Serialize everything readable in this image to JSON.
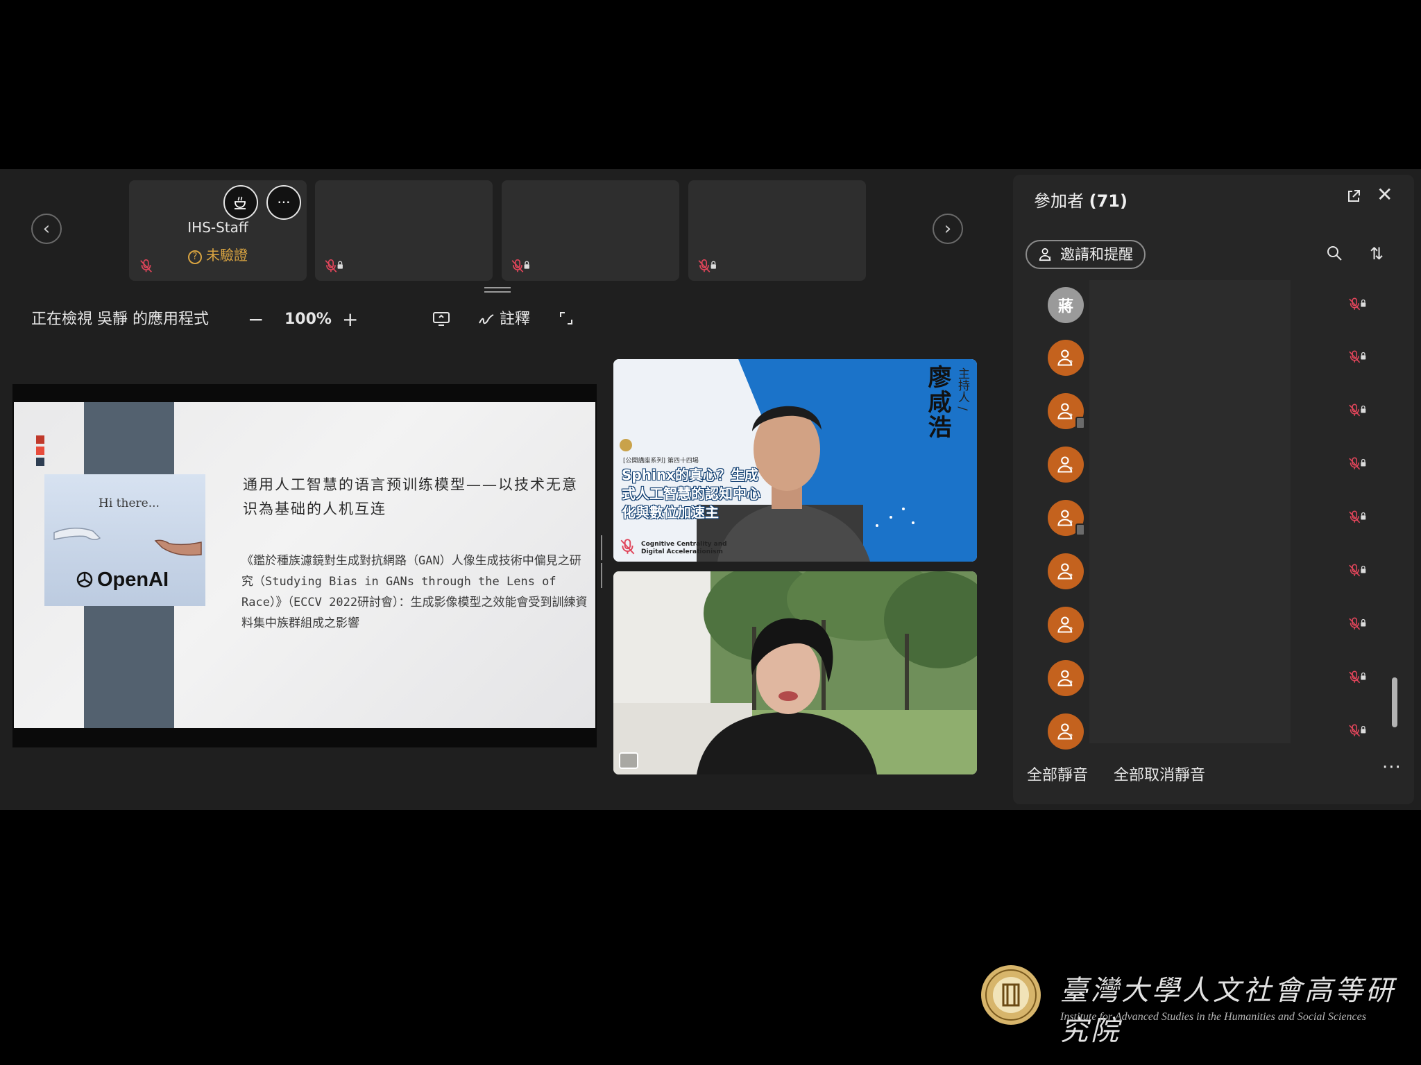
{
  "thumbnails": [
    {
      "name": "IHS-Staff",
      "status": "未驗證"
    },
    {
      "name": "",
      "status": ""
    },
    {
      "name": "",
      "status": ""
    },
    {
      "name": "",
      "status": ""
    }
  ],
  "toolbar": {
    "viewing_label": "正在檢視 吳靜 的應用程式",
    "zoom_minus": "−",
    "zoom_level": "100%",
    "zoom_plus": "+",
    "annotate_label": "註釋"
  },
  "slide": {
    "title": "通用人工智慧的语言预训练模型——以技术无意识為基础的人机互连",
    "body": "《鑑於種族濾鏡對生成對抗網路（GAN）人像生成技術中偏見之研究（Studying Bias in GANs through the Lens of Race）》（ECCV 2022研討會）：生成影像模型之效能會受到訓練資料集中族群組成之影響",
    "image_caption": "Hi there...",
    "image_logo": "OpenAI",
    "accent_colors": [
      "#c0392b",
      "#e74c3c",
      "#2e3e52"
    ]
  },
  "video_host": {
    "name": "廖咸浩",
    "role": "主持人 /",
    "poster_series": "[公開講座系列] 第四十四場",
    "poster_title": "Sphinx的真心？生成式人工智慧的認知中心化與數位加速主",
    "poster_subtitle": "Cognitive Centrality and Digital Accelerationism"
  },
  "video_guest": {
    "name": ""
  },
  "panel": {
    "title": "參加者",
    "count": "(71)",
    "invite_label": "邀請和提醒",
    "participants": [
      {
        "avatar_text": "蔣",
        "type": "initial"
      },
      {
        "avatar_text": "",
        "type": "guest"
      },
      {
        "avatar_text": "",
        "type": "guest-phone"
      },
      {
        "avatar_text": "",
        "type": "guest"
      },
      {
        "avatar_text": "",
        "type": "guest-phone"
      },
      {
        "avatar_text": "",
        "type": "guest"
      },
      {
        "avatar_text": "",
        "type": "guest"
      },
      {
        "avatar_text": "",
        "type": "guest"
      },
      {
        "avatar_text": "",
        "type": "guest"
      }
    ],
    "mute_all": "全部靜音",
    "unmute_all": "全部取消靜音",
    "more": "···"
  },
  "brand": {
    "name_zh": "臺灣大學人文社會高等研究院",
    "name_en": "Institute for Advanced Studies in the Humanities and Social Sciences"
  },
  "colors": {
    "app_bg": "#1f1f1f",
    "panel_bg": "#262626",
    "avatar_orange": "#c4621e",
    "mic_muted_red": "#e0455a",
    "warning_amber": "#d9a441",
    "host_blue": "#1b73c9"
  }
}
